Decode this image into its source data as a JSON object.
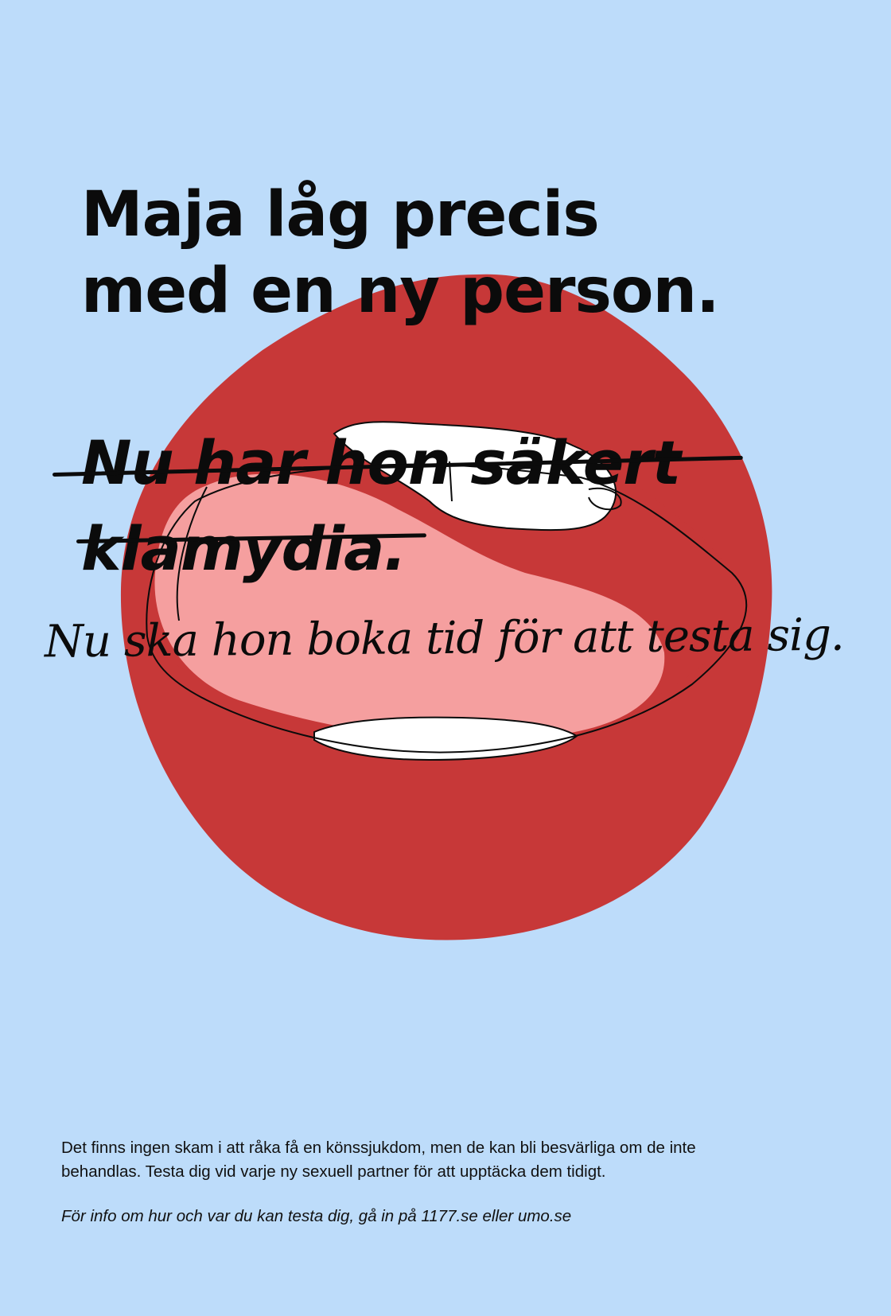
{
  "colors": {
    "background": "#bddcfa",
    "lips": "#c73838",
    "tongue": "#f59f9f",
    "teeth": "#ffffff",
    "ink": "#0b0b0b"
  },
  "headline": {
    "line1": "Maja låg precis",
    "line2": "med en ny person."
  },
  "struck_text": {
    "line1": "Nu har hon säkert",
    "line2": "klamydia."
  },
  "handwritten_text": "Nu ska hon boka tid för att testa sig.",
  "body": {
    "line1": "Det finns ingen skam i att råka få en könssjukdom, men de kan bli besvärliga om de inte",
    "line2": "behandlas. Testa dig vid varje ny sexuell partner för att upptäcka dem tidigt."
  },
  "info": "För info om hur och var du kan testa dig, gå in på 1177.se eller umo.se"
}
